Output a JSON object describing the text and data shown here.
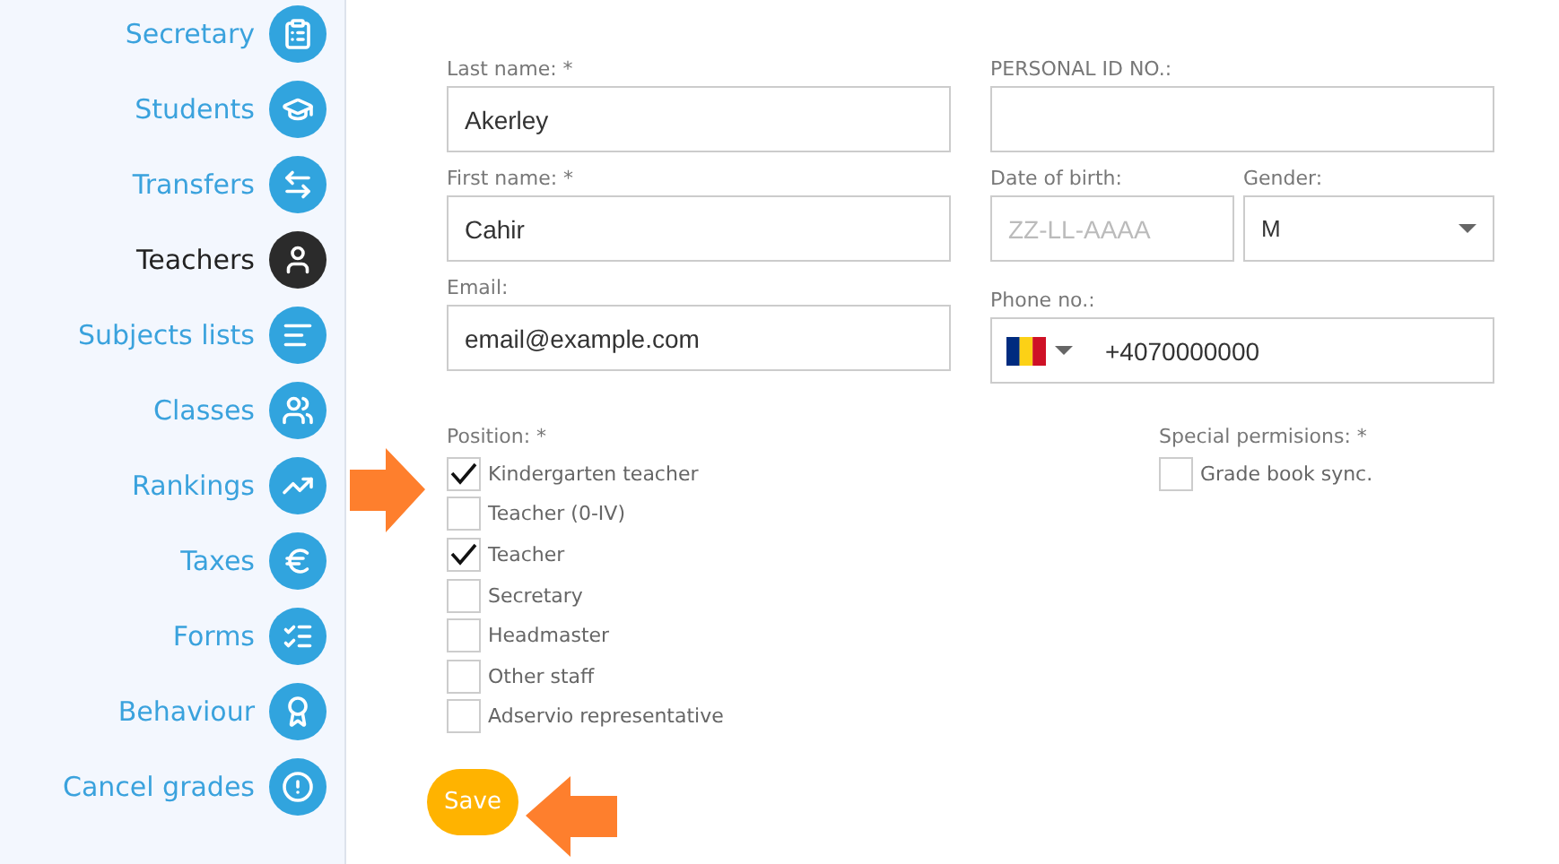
{
  "sidebar": {
    "items": [
      {
        "label": "Secretary",
        "selected": false
      },
      {
        "label": "Students",
        "selected": false
      },
      {
        "label": "Transfers",
        "selected": false
      },
      {
        "label": "Teachers",
        "selected": true
      },
      {
        "label": "Subjects lists",
        "selected": false
      },
      {
        "label": "Classes",
        "selected": false
      },
      {
        "label": "Rankings",
        "selected": false
      },
      {
        "label": "Taxes",
        "selected": false
      },
      {
        "label": "Forms",
        "selected": false
      },
      {
        "label": "Behaviour",
        "selected": false
      },
      {
        "label": "Cancel grades",
        "selected": false
      }
    ]
  },
  "form": {
    "last_name": {
      "label": "Last name: *",
      "value": "Akerley"
    },
    "personal_id": {
      "label": "PERSONAL ID NO.:"
    },
    "first_name": {
      "label": "First name: *",
      "value": "Cahir"
    },
    "date_of_birth": {
      "label": "Date of birth:",
      "placeholder": "ZZ-LL-AAAA"
    },
    "gender": {
      "label": "Gender:",
      "value": "M"
    },
    "email": {
      "label": "Email:",
      "value": "email@example.com"
    },
    "phone": {
      "label": "Phone no.:",
      "value": "+4070000000"
    },
    "position": {
      "label": "Position: *",
      "options": [
        {
          "label": "Kindergarten teacher",
          "checked": true
        },
        {
          "label": "Teacher (0-IV)",
          "checked": false
        },
        {
          "label": "Teacher",
          "checked": true
        },
        {
          "label": "Secretary",
          "checked": false
        },
        {
          "label": "Headmaster",
          "checked": false
        },
        {
          "label": "Other staff",
          "checked": false
        },
        {
          "label": "Adservio representative",
          "checked": false
        }
      ]
    },
    "special_permissions": {
      "label": "Special permisions: *",
      "options": [
        {
          "label": "Grade book sync.",
          "checked": false
        }
      ]
    },
    "save_button": "Save"
  }
}
